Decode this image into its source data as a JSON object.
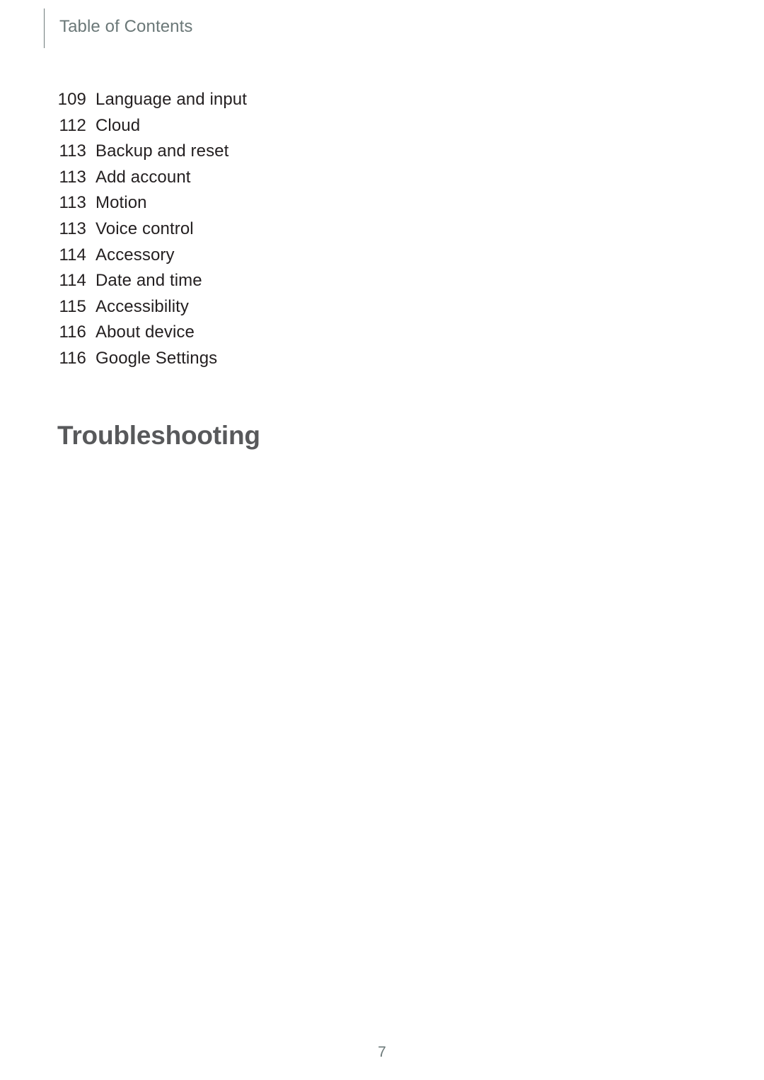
{
  "document": {
    "background_color": "#ffffff",
    "body_text_color": "#231f20",
    "accent_gray": "#6b7878",
    "heading_color": "#58595b"
  },
  "header": {
    "title": "Table of Contents",
    "rule_color": "#6f7b7b"
  },
  "toc": {
    "entries": [
      {
        "page": "109",
        "label": "Language and input"
      },
      {
        "page": "112",
        "label": "Cloud"
      },
      {
        "page": "113",
        "label": "Backup and reset"
      },
      {
        "page": "113",
        "label": "Add account"
      },
      {
        "page": "113",
        "label": "Motion"
      },
      {
        "page": "113",
        "label": "Voice control"
      },
      {
        "page": "114",
        "label": "Accessory"
      },
      {
        "page": "114",
        "label": "Date and time"
      },
      {
        "page": "115",
        "label": "Accessibility"
      },
      {
        "page": "116",
        "label": "About device"
      },
      {
        "page": "116",
        "label": "Google Settings"
      }
    ]
  },
  "section": {
    "heading": "Troubleshooting"
  },
  "footer": {
    "page_number": "7"
  }
}
